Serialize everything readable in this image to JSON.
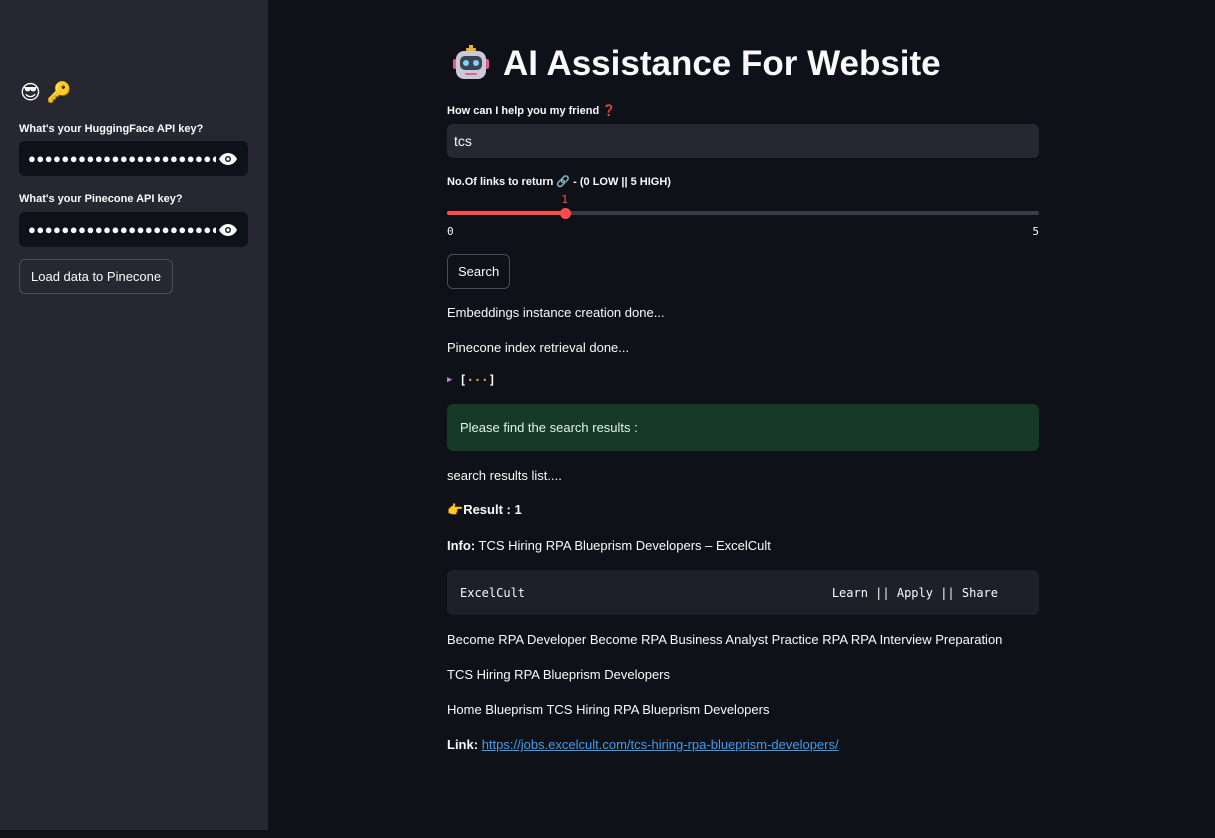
{
  "sidebar": {
    "emojis": [
      "😎",
      "🔑"
    ],
    "hf_label": "What's your HuggingFace API key?",
    "hf_value": "●●●●●●●●●●●●●●●●●●●●●●●",
    "pc_label": "What's your Pinecone API key?",
    "pc_value": "●●●●●●●●●●●●●●●●●●●●●●●",
    "load_button": "Load data to Pinecone"
  },
  "main": {
    "title": "AI Assistance For Website",
    "question_label": "How can I help you my friend ❓",
    "question_value": "tcs",
    "slider_label": "No.Of links to return 🔗 - (0 LOW || 5 HIGH)",
    "slider": {
      "min": "0",
      "max": "5",
      "value": "1",
      "fraction": 0.2
    },
    "search_button": "Search",
    "status1": "Embeddings instance creation done...",
    "status2": "Pinecone index retrieval done...",
    "expander_open": "[",
    "expander_dots": "···",
    "expander_close": "]",
    "success_msg": "Please find the search results :",
    "results_heading": "search results list....",
    "result_emoji": "👉",
    "result_label": "Result : 1",
    "info_label": "Info:",
    "info_value": "TCS Hiring RPA Blueprism Developers – ExcelCult",
    "code_left": "ExcelCult",
    "code_right": "Learn || Apply || Share",
    "line1": "Become RPA Developer Become RPA Business Analyst Practice RPA RPA Interview Preparation",
    "line2": "TCS Hiring RPA Blueprism Developers",
    "line3": "Home Blueprism TCS Hiring RPA Blueprism Developers",
    "link_label": "Link:",
    "link_url": "https://jobs.excelcult.com/tcs-hiring-rpa-blueprism-developers/"
  },
  "colors": {
    "accent": "#ff4b4b",
    "success_bg": "#173928",
    "link": "#3d9df3"
  }
}
